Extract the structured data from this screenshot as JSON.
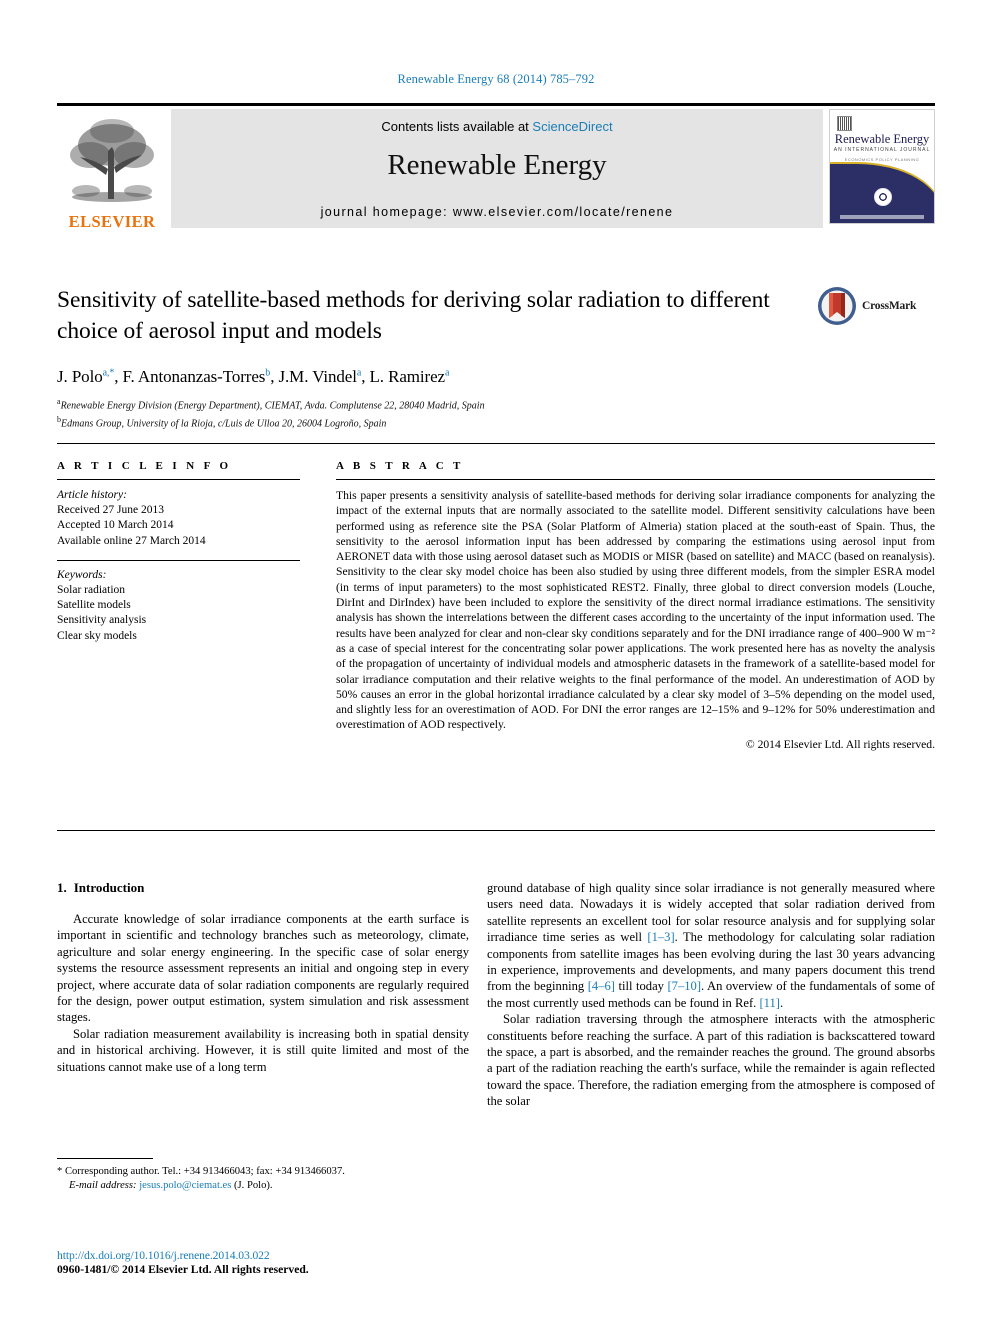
{
  "running_head": "Renewable Energy 68 (2014) 785–792",
  "masthead": {
    "contents_prefix": "Contents lists available at ",
    "sciencedirect": "ScienceDirect",
    "journal_name": "Renewable Energy",
    "homepage": "journal homepage: www.elsevier.com/locate/renene",
    "publisher_wordmark": "ELSEVIER",
    "cover": {
      "title": "Renewable Energy",
      "subtitle": "AN INTERNATIONAL JOURNAL",
      "subtitle2": "ECONOMICS  POLICY  PLANNING"
    }
  },
  "article": {
    "title": "Sensitivity of satellite-based methods for deriving solar radiation to different choice of aerosol input and models",
    "authors": [
      {
        "name": "J. Polo",
        "marks": "a,*"
      },
      {
        "name": "F. Antonanzas-Torres",
        "marks": "b"
      },
      {
        "name": "J.M. Vindel",
        "marks": "a"
      },
      {
        "name": "L. Ramirez",
        "marks": "a"
      }
    ],
    "affiliations": [
      {
        "mark": "a",
        "text": "Renewable Energy Division (Energy Department), CIEMAT, Avda. Complutense 22, 28040 Madrid, Spain"
      },
      {
        "mark": "b",
        "text": "Edmans Group, University of la Rioja, c/Luis de Ulloa 20, 26004 Logroño, Spain"
      }
    ],
    "crossmark_label": "CrossMark"
  },
  "article_info": {
    "heading": "A R T I C L E  I N F O",
    "history_label": "Article history:",
    "history": [
      "Received 27 June 2013",
      "Accepted 10 March 2014",
      "Available online 27 March 2014"
    ],
    "keywords_label": "Keywords:",
    "keywords": [
      "Solar radiation",
      "Satellite models",
      "Sensitivity analysis",
      "Clear sky models"
    ]
  },
  "abstract": {
    "heading": "A B S T R A C T",
    "text": "This paper presents a sensitivity analysis of satellite-based methods for deriving solar irradiance components for analyzing the impact of the external inputs that are normally associated to the satellite model. Different sensitivity calculations have been performed using as reference site the PSA (Solar Platform of Almeria) station placed at the south-east of Spain. Thus, the sensitivity to the aerosol information input has been addressed by comparing the estimations using aerosol input from AERONET data with those using aerosol dataset such as MODIS or MISR (based on satellite) and MACC (based on reanalysis). Sensitivity to the clear sky model choice has been also studied by using three different models, from the simpler ESRA model (in terms of input parameters) to the most sophisticated REST2. Finally, three global to direct conversion models (Louche, DirInt and DirIndex) have been included to explore the sensitivity of the direct normal irradiance estimations. The sensitivity analysis has shown the interrelations between the different cases according to the uncertainty of the input information used. The results have been analyzed for clear and non-clear sky conditions separately and for the DNI irradiance range of 400–900 W m⁻² as a case of special interest for the concentrating solar power applications. The work presented here has as novelty the analysis of the propagation of uncertainty of individual models and atmospheric datasets in the framework of a satellite-based model for solar irradiance computation and their relative weights to the final performance of the model. An underestimation of AOD by 50% causes an error in the global horizontal irradiance calculated by a clear sky model of 3–5% depending on the model used, and slightly less for an overestimation of AOD. For DNI the error ranges are 12–15% and 9–12% for 50% underestimation and overestimation of AOD respectively.",
    "copyright": "© 2014 Elsevier Ltd. All rights reserved."
  },
  "introduction": {
    "number": "1.",
    "heading": "Introduction",
    "left_p1": "Accurate knowledge of solar irradiance components at the earth surface is important in scientific and technology branches such as meteorology, climate, agriculture and solar energy engineering. In the specific case of solar energy systems the resource assessment represents an initial and ongoing step in every project, where accurate data of solar radiation components are regularly required for the design, power output estimation, system simulation and risk assessment stages.",
    "left_p2": "Solar radiation measurement availability is increasing both in spatial density and in historical archiving. However, it is still quite limited and most of the situations cannot make use of a long term",
    "right_p1_a": "ground database of high quality since solar irradiance is not generally measured where users need data. Nowadays it is widely accepted that solar radiation derived from satellite represents an excellent tool for solar resource analysis and for supplying solar irradiance time series as well ",
    "right_cite_1": "[1–3]",
    "right_p1_b": ". The methodology for calculating solar radiation components from satellite images has been evolving during the last 30 years advancing in experience, improvements and developments, and many papers document this trend from the beginning ",
    "right_cite_2": "[4–6]",
    "right_p1_c": " till today ",
    "right_cite_3": "[7–10]",
    "right_p1_d": ". An overview of the fundamentals of some of the most currently used methods can be found in Ref. ",
    "right_cite_4": "[11]",
    "right_p1_e": ".",
    "right_p2": "Solar radiation traversing through the atmosphere interacts with the atmospheric constituents before reaching the surface. A part of this radiation is backscattered toward the space, a part is absorbed, and the remainder reaches the ground. The ground absorbs a part of the radiation reaching the earth's surface, while the remainder is again reflected toward the space. Therefore, the radiation emerging from the atmosphere is composed of the solar"
  },
  "footnote": {
    "star": "*",
    "corresponding": " Corresponding author. Tel.: +34 913466043; fax: +34 913466037.",
    "email_label": "E-mail address:",
    "email": "jesus.polo@ciemat.es",
    "email_suffix": " (J. Polo)."
  },
  "footer": {
    "doi": "http://dx.doi.org/10.1016/j.renene.2014.03.022",
    "issn": "0960-1481/© 2014 Elsevier Ltd. All rights reserved."
  },
  "colors": {
    "link": "#1a7db6",
    "elsevier_orange": "#e8730c",
    "cover_navy": "#2c2f66",
    "cover_gold": "#d8b12a"
  }
}
